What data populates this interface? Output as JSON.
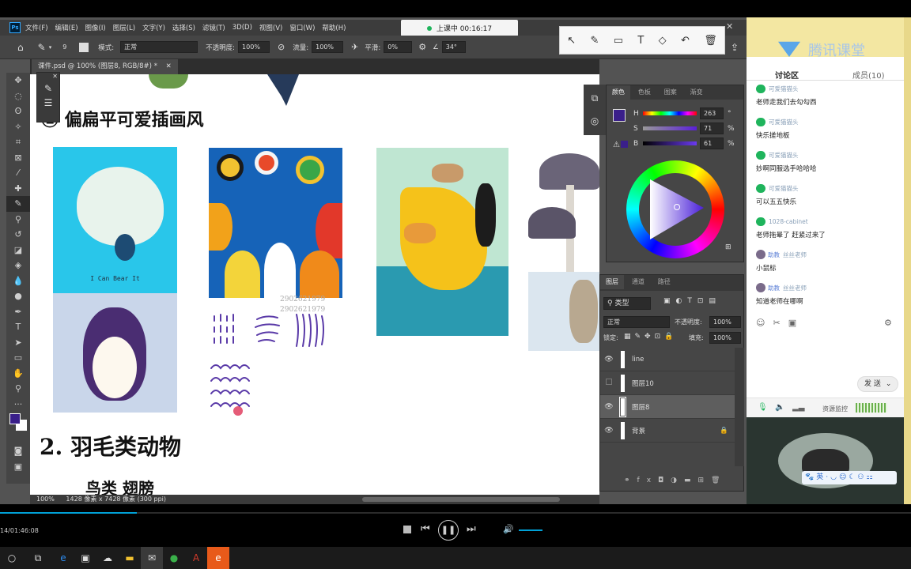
{
  "menubar": {
    "app_icon": "Ps",
    "items": [
      "文件(F)",
      "编辑(E)",
      "图像(I)",
      "图层(L)",
      "文字(Y)",
      "选择(S)",
      "滤镜(T)",
      "3D(D)",
      "视图(V)",
      "窗口(W)",
      "帮助(H)"
    ]
  },
  "options": {
    "brush_size": "9",
    "mode_label": "模式:",
    "mode_value": "正常",
    "opacity_label": "不透明度:",
    "opacity_value": "100%",
    "flow_label": "流量:",
    "flow_value": "100%",
    "smoothing_label": "平滑:",
    "smoothing_value": "0%",
    "angle_value": "34°"
  },
  "document": {
    "tab_title": "课件.psd @ 100% (图层8, RGB/8#) *",
    "zoom": "100%",
    "doc_info": "1428 像素 x 7428 像素 (300 ppi)"
  },
  "canvas": {
    "heading1": "② 偏扁平可爱插画风",
    "card1_caption": "I Can Bear It",
    "watermark1": "2902621979",
    "watermark2": "2902621979",
    "heading2": "2. 羽毛类动物",
    "subheading": "鸟类 翅膀"
  },
  "timer": {
    "status": "上课中 00:16:17"
  },
  "color_panel": {
    "tabs": [
      "颜色",
      "色板",
      "图案",
      "渐变"
    ],
    "h_label": "H",
    "h_value": "263",
    "h_unit": "°",
    "s_label": "S",
    "s_value": "71",
    "s_unit": "%",
    "b_label": "B",
    "b_value": "61",
    "b_unit": "%",
    "foreground": "#3a1f8a"
  },
  "layers_panel": {
    "tabs": [
      "图层",
      "通道",
      "路径"
    ],
    "filter_kind": "类型",
    "blend_mode": "正常",
    "opacity_label": "不透明度:",
    "opacity_value": "100%",
    "lock_label": "锁定:",
    "fill_label": "填充:",
    "fill_value": "100%",
    "layers": [
      {
        "name": "line",
        "visible": true,
        "selected": false
      },
      {
        "name": "图层10",
        "visible": false,
        "selected": false
      },
      {
        "name": "图层8",
        "visible": true,
        "selected": true
      },
      {
        "name": "背景",
        "visible": true,
        "selected": false,
        "locked": true
      }
    ]
  },
  "chat": {
    "brand": "腾讯课堂",
    "tab_discussion": "讨论区",
    "tab_members": "成员(10)",
    "messages": [
      {
        "name": "可爱猫猫头",
        "text": "老师走我们去勾勾西",
        "teacher": false
      },
      {
        "name": "可爱猫猫头",
        "text": "快乐搓地板",
        "teacher": false
      },
      {
        "name": "可爱猫猫头",
        "text": "妙啊同服选手哈哈哈",
        "teacher": false
      },
      {
        "name": "可爱猫猫头",
        "text": "可以五五快乐",
        "teacher": false
      },
      {
        "name": "1028-cabinet",
        "text": "老师拖晕了 赶紧过来了",
        "teacher": false
      },
      {
        "name": "丝丝老师",
        "badge": "助教",
        "text": "小鼠标",
        "teacher": true
      },
      {
        "name": "丝丝老师",
        "badge": "助教",
        "text": "知道老师在哪啊",
        "teacher": true
      }
    ],
    "send_label": "发 送",
    "resource_label": "资源监控"
  },
  "player": {
    "time": "14/01:46:08",
    "progress": 0.15
  },
  "ime": {
    "lang": "英"
  }
}
